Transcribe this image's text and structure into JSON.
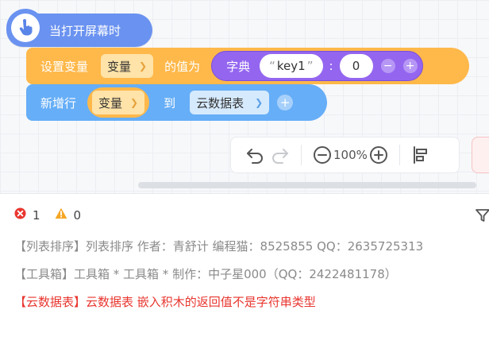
{
  "blocks": {
    "hat": {
      "label": "当打开屏幕时"
    },
    "set_var": {
      "label": "设置变量",
      "var_dropdown": "变量",
      "value_label": "的值为",
      "dict_label": "字典",
      "key_value": "key1",
      "num_value": "0"
    },
    "add_row": {
      "label": "新增行",
      "var_dropdown": "变量",
      "to_label": "到",
      "table_dropdown": "云数据表"
    }
  },
  "toolbar": {
    "zoom": "100%"
  },
  "console": {
    "error_count": "1",
    "warning_count": "0",
    "logs": [
      {
        "text": "【列表排序】列表排序 作者：青舒计 编程猫：8525855 QQ：2635725313",
        "level": "info"
      },
      {
        "text": "【工具箱】工具箱 * 工具箱 * 制作：中子星000（QQ：2422481178）",
        "level": "info"
      },
      {
        "text": "【云数据表】云数据表 嵌入积木的返回值不是字符串类型",
        "level": "error"
      }
    ]
  },
  "colors": {
    "hat": "#6a92f0",
    "set_block": "#ffb84a",
    "dict_block": "#9466f0",
    "add_block": "#66aef7",
    "error": "#e8362f",
    "warning": "#f5a623"
  },
  "icons": [
    "pointer-hand-icon",
    "undo-icon",
    "redo-icon",
    "zoom-out-icon",
    "zoom-in-icon",
    "align-icon",
    "error-icon",
    "warning-icon",
    "filter-icon"
  ]
}
